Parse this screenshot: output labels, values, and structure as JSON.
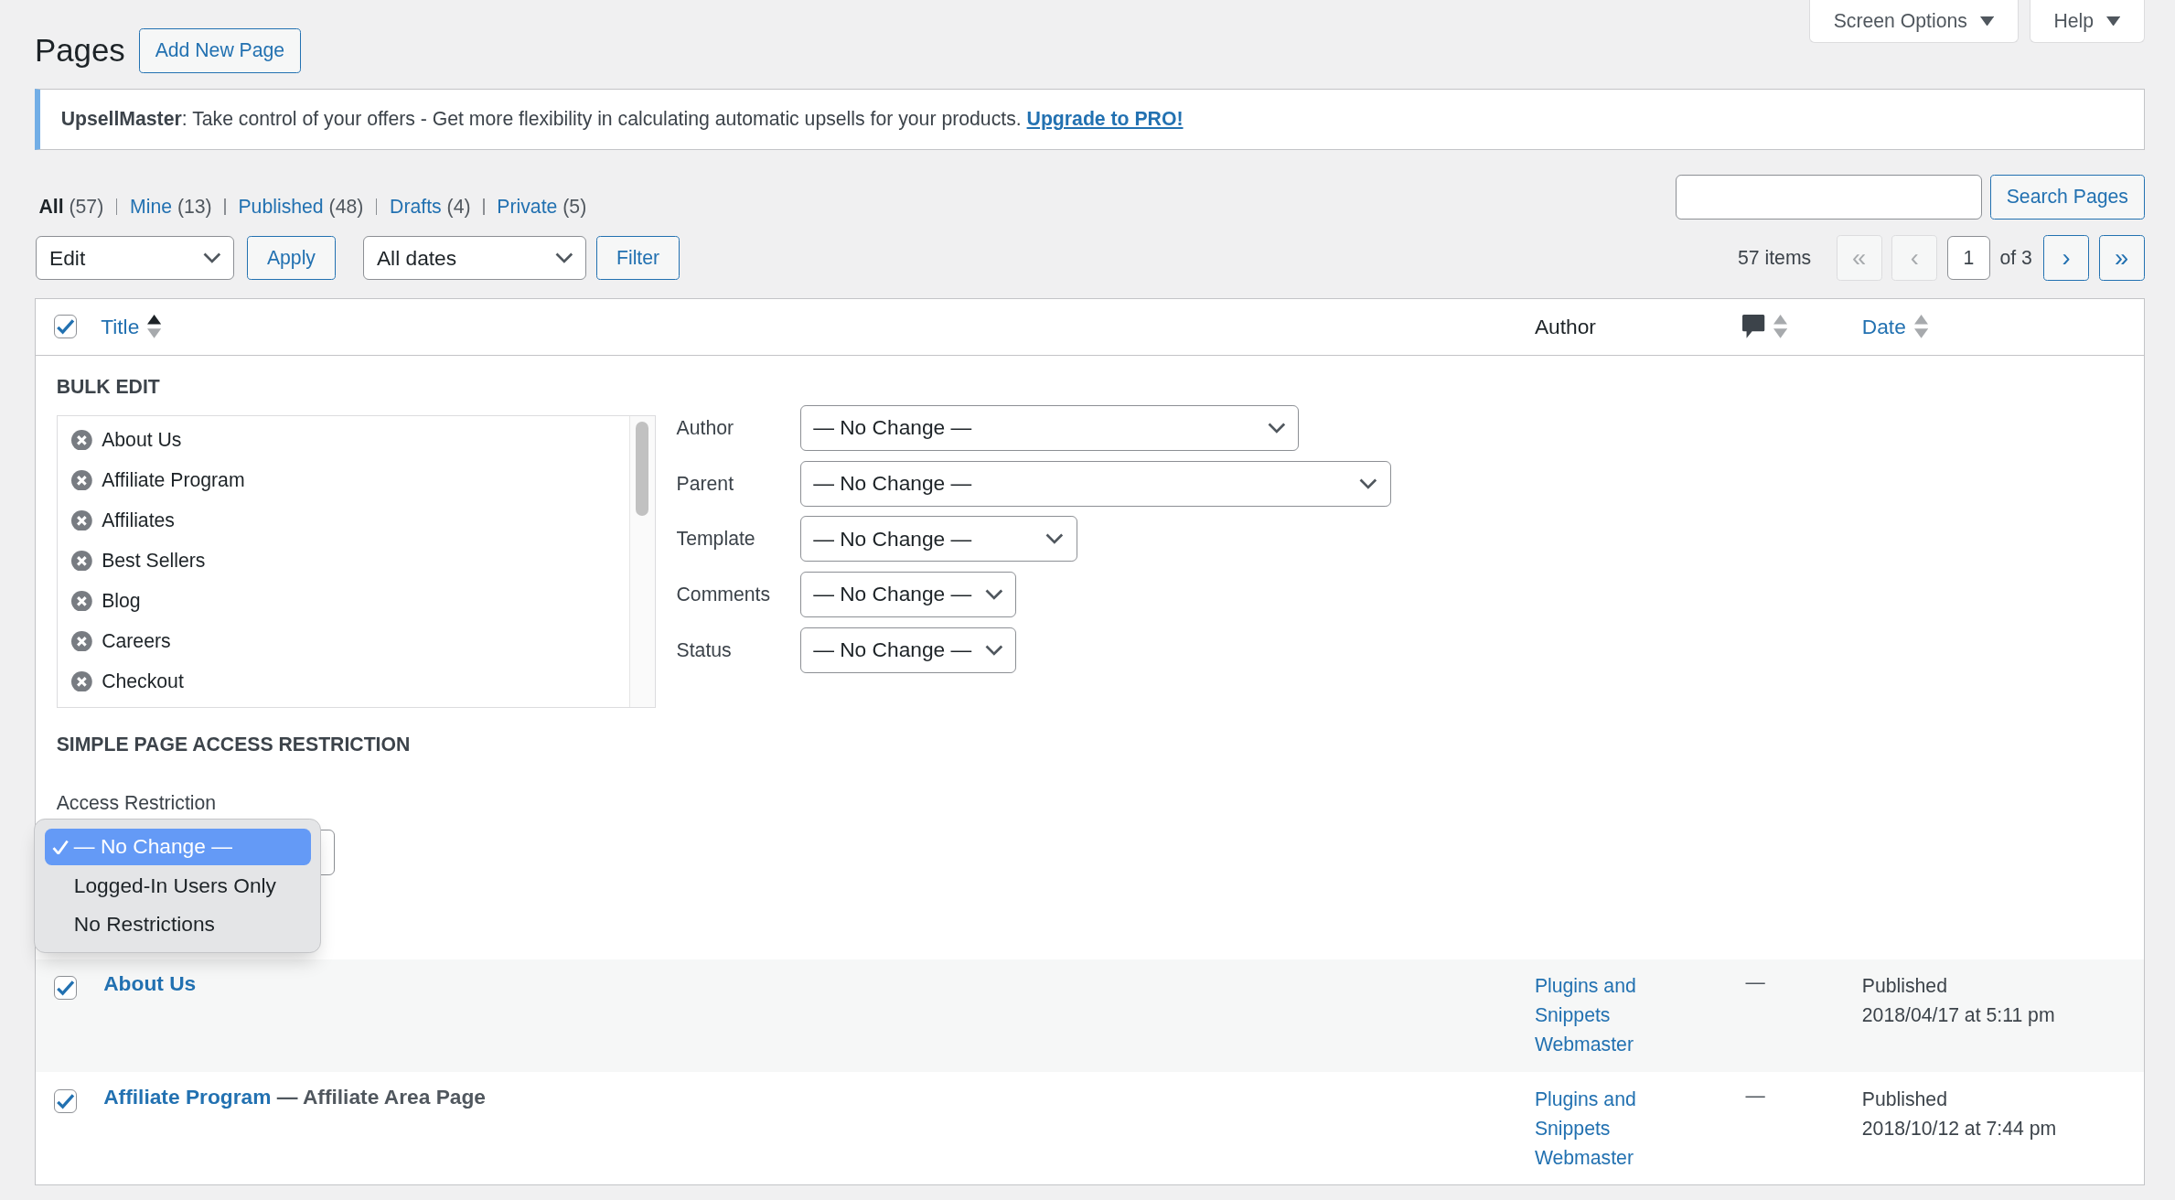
{
  "screen_tabs": [
    {
      "label": "Screen Options"
    },
    {
      "label": "Help"
    }
  ],
  "page_title": "Pages",
  "add_button": "Add New Page",
  "notice": {
    "text": "**UpsellMaster**: Take control of your offers - Get more flexibility in calculating automatic upsells for your products.",
    "link": "Upgrade to PRO!"
  },
  "views": [
    {
      "label": "All",
      "count": "(57)",
      "selected": true
    },
    {
      "label": "Mine",
      "count": "(13)",
      "selected": false
    },
    {
      "label": "Published",
      "count": "(48)",
      "selected": false
    },
    {
      "label": "Drafts",
      "count": "(4)",
      "selected": false
    },
    {
      "label": "Private",
      "count": "(5)",
      "selected": false
    }
  ],
  "search": {
    "button": "Search Pages"
  },
  "bulk_action": {
    "value": "Edit",
    "button": "Apply"
  },
  "date_filter": {
    "value": "All dates",
    "button": "Filter"
  },
  "pagination": {
    "count": "57 items",
    "buttons": [
      {
        "label": "«",
        "disabled": true
      },
      {
        "label": "‹",
        "disabled": true
      },
      {
        "label": "›",
        "disabled": false
      },
      {
        "label": "»",
        "disabled": false
      }
    ],
    "page": "1",
    "total": "of 3"
  },
  "table": {
    "select_all_checked": true,
    "columns": [
      {
        "kind": "link",
        "label": "Title",
        "sorted": true
      },
      {
        "kind": "text",
        "label": "Author"
      },
      {
        "kind": "comments",
        "sorted": false
      },
      {
        "kind": "link",
        "label": "Date",
        "sorted": false
      }
    ],
    "bulk_edit": {
      "title": "BULK EDIT",
      "pages": [
        "About Us",
        "Affiliate Program",
        "Affiliates",
        "Best Sellers",
        "Blog",
        "Careers",
        "Checkout"
      ],
      "fields": [
        {
          "label": "Author",
          "value": "— No Change —"
        },
        {
          "label": "Parent",
          "value": "— No Change —"
        },
        {
          "label": "Template",
          "value": "— No Change —"
        },
        {
          "label": "Comments",
          "value": "— No Change —"
        },
        {
          "label": "Status",
          "value": "— No Change —"
        }
      ],
      "access_title": "SIMPLE PAGE ACCESS RESTRICTION",
      "access_label": "Access Restriction",
      "access_menu": [
        {
          "label": "— No Change —",
          "selected": true
        },
        {
          "label": "Logged-In Users Only",
          "selected": false
        },
        {
          "label": "No Restrictions",
          "selected": false
        }
      ]
    },
    "rows": [
      {
        "checked": true,
        "title": "About Us",
        "author": "Plugins and Snippets Webmaster",
        "comments": "—",
        "status": "Published",
        "date": "2018/04/17 at 5:11 pm"
      },
      {
        "checked": true,
        "title": "Affiliate Program",
        "suffix": "— Affiliate Area Page",
        "author": "Plugins and Snippets Webmaster",
        "comments": "—",
        "status": "Published",
        "date": "2018/10/12 at 7:44 pm"
      }
    ]
  }
}
